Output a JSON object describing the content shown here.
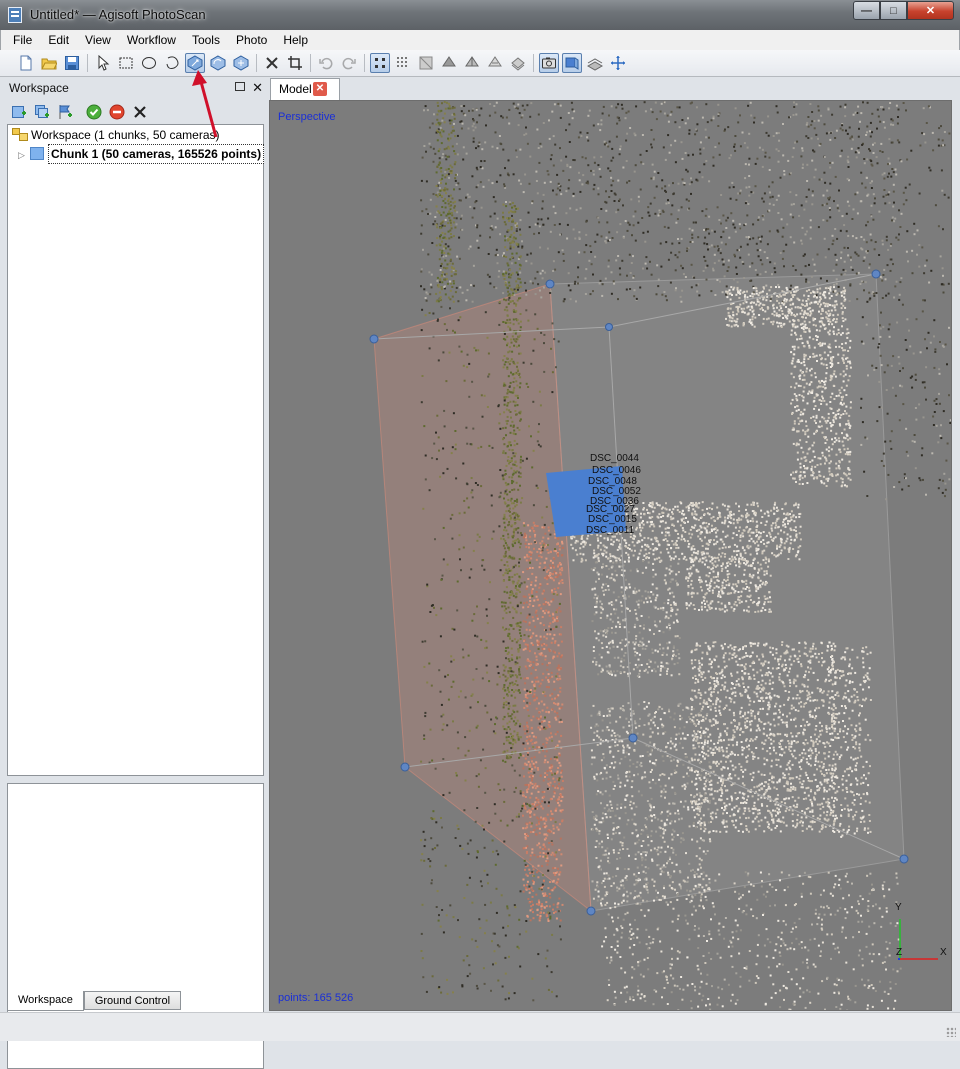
{
  "window": {
    "title": "Untitled* — Agisoft PhotoScan",
    "min_symbol": "—",
    "max_symbol": "□",
    "close_symbol": "✕"
  },
  "menu": [
    "File",
    "Edit",
    "View",
    "Workflow",
    "Tools",
    "Photo",
    "Help"
  ],
  "toolbar": {
    "buttons": [
      {
        "name": "new-icon"
      },
      {
        "name": "open-icon"
      },
      {
        "name": "save-icon"
      },
      {
        "name": "navigation-icon"
      },
      {
        "name": "rectangle-selection-icon"
      },
      {
        "name": "circle-selection-icon"
      },
      {
        "name": "free-form-selection-icon"
      },
      {
        "name": "resize-region-icon",
        "active": true
      },
      {
        "name": "rotate-region-icon"
      },
      {
        "name": "move-region-icon"
      },
      {
        "name": "delete-selection-icon"
      },
      {
        "name": "crop-selection-icon"
      },
      {
        "name": "undo-icon"
      },
      {
        "name": "redo-icon"
      },
      {
        "name": "point-cloud-icon",
        "active": true
      },
      {
        "name": "dense-cloud-icon"
      },
      {
        "name": "shaded-model-icon"
      },
      {
        "name": "solid-model-icon"
      },
      {
        "name": "wireframe-model-icon"
      },
      {
        "name": "textured-model-icon"
      },
      {
        "name": "tiled-model-icon"
      },
      {
        "name": "show-cameras-icon",
        "active": true
      },
      {
        "name": "show-region-icon",
        "active": true
      },
      {
        "name": "show-grid-icon"
      },
      {
        "name": "center-view-icon"
      }
    ]
  },
  "workspace_panel": {
    "title": "Workspace",
    "close_symbol": "✕",
    "tree": {
      "root_label": "Workspace (1 chunks, 50 cameras)",
      "chunk_label": "Chunk 1 (50 cameras, 165526 points)"
    },
    "bottom_tabs": [
      "Workspace",
      "Ground Control"
    ]
  },
  "model_view": {
    "tab_label": "Model",
    "projection_label": "Perspective",
    "points_label": "points: 165 526",
    "axes": {
      "y": "Y",
      "z": "Z",
      "x": "X"
    }
  },
  "colors": {
    "viewport_bg": "#7c7c7c",
    "region_box": "#d48b7a",
    "selected_cameras": "#4a7fd0",
    "label_blue": "#1a2fd6",
    "annotation_arrow": "#d0102a"
  }
}
